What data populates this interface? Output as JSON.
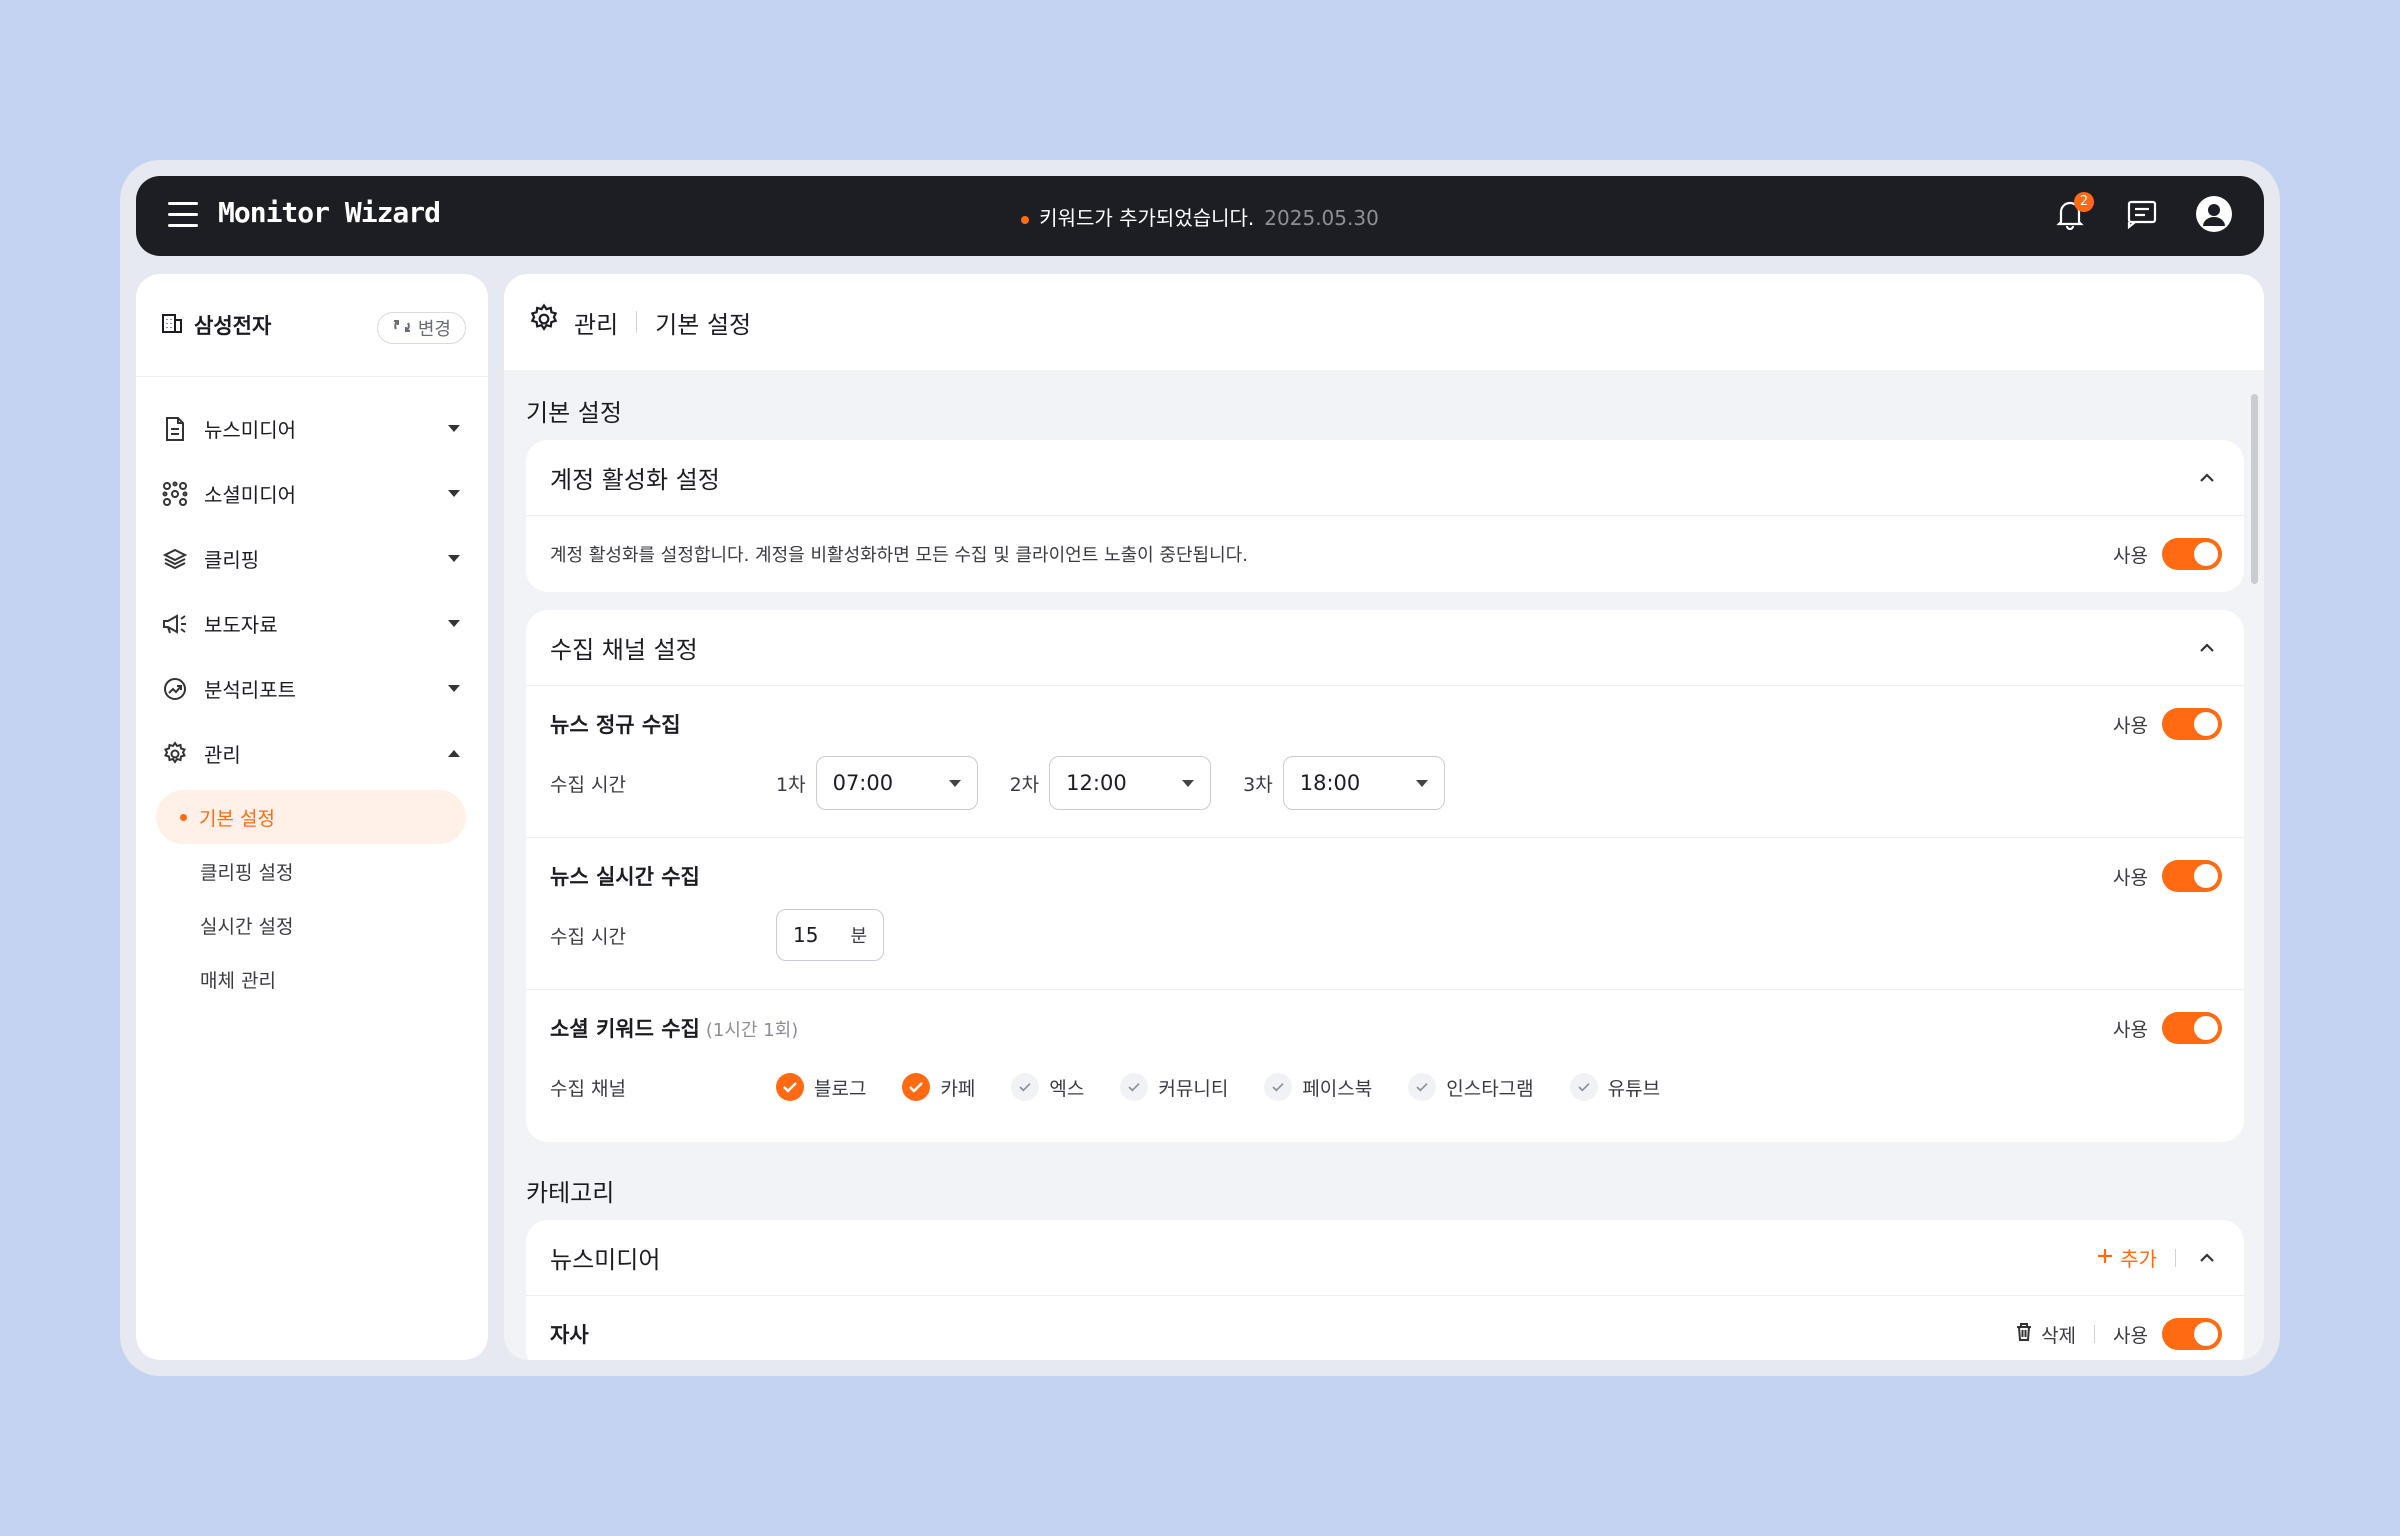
{
  "app": {
    "brand": "Monitor Wizard",
    "notice_text": "키워드가 추가되었습니다.",
    "notice_date": "2025.05.30",
    "notification_count": "2"
  },
  "sidebar": {
    "company": "삼성전자",
    "change_label": "변경",
    "nav": [
      {
        "label": "뉴스미디어",
        "icon": "document-icon"
      },
      {
        "label": "소셜미디어",
        "icon": "network-icon"
      },
      {
        "label": "클리핑",
        "icon": "layers-icon"
      },
      {
        "label": "보도자료",
        "icon": "megaphone-icon"
      },
      {
        "label": "분석리포트",
        "icon": "trend-icon"
      },
      {
        "label": "관리",
        "icon": "gear-icon"
      }
    ],
    "sub_items": [
      "기본 설정",
      "클리핑 설정",
      "실시간 설정",
      "매체 관리"
    ]
  },
  "header": {
    "crumb1": "관리",
    "crumb2": "기본 설정"
  },
  "sections": {
    "basic_title": "기본 설정",
    "category_title": "카테고리"
  },
  "account_card": {
    "title": "계정 활성화 설정",
    "description": "계정 활성화를 설정합니다. 계정을 비활성화하면 모든 수집 및 클라이언트 노출이 중단됩니다.",
    "use_label": "사용"
  },
  "channel_card": {
    "title": "수집 채널 설정",
    "news_regular": {
      "title": "뉴스 정규 수집",
      "use_label": "사용",
      "field_label": "수집 시간",
      "times": [
        {
          "n": "1차",
          "value": "07:00"
        },
        {
          "n": "2차",
          "value": "12:00"
        },
        {
          "n": "3차",
          "value": "18:00"
        }
      ]
    },
    "news_realtime": {
      "title": "뉴스 실시간 수집",
      "use_label": "사용",
      "field_label": "수집 시간",
      "value": "15",
      "unit": "분"
    },
    "social": {
      "title": "소셜 키워드 수집",
      "hint": "(1시간 1회)",
      "use_label": "사용",
      "field_label": "수집 채널",
      "channels": [
        {
          "label": "블로그",
          "checked": true
        },
        {
          "label": "카페",
          "checked": true
        },
        {
          "label": "엑스",
          "checked": false
        },
        {
          "label": "커뮤니티",
          "checked": false
        },
        {
          "label": "페이스북",
          "checked": false
        },
        {
          "label": "인스타그램",
          "checked": false
        },
        {
          "label": "유튜브",
          "checked": false
        }
      ]
    }
  },
  "category_card": {
    "title": "뉴스미디어",
    "add_label": "추가",
    "row_title": "자사",
    "delete_label": "삭제",
    "use_label": "사용"
  },
  "colors": {
    "accent": "#ff6a13",
    "topbar": "#1d1e23",
    "background": "#c3d3f1"
  }
}
